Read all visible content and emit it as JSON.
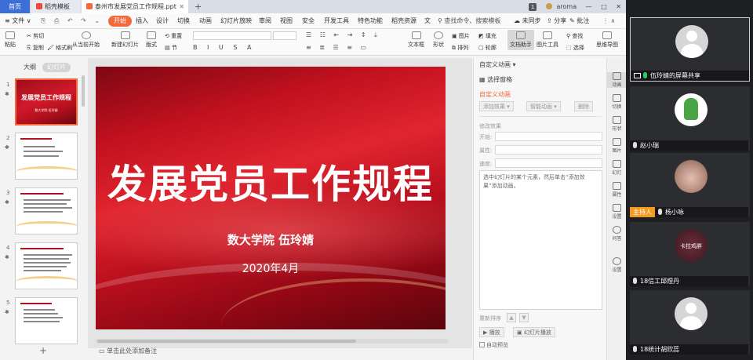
{
  "tabs": {
    "home": "首页",
    "t1": "稻壳模板",
    "t2": "泰州市发展党员工作规程.ppt",
    "plus": "+",
    "badge": "1",
    "user": "aroma",
    "min": "—",
    "max": "□",
    "close": "✕"
  },
  "menu": {
    "file": "≡ 文件 ∨",
    "items": [
      "开始",
      "插入",
      "设计",
      "切换",
      "动画",
      "幻灯片放映",
      "审阅",
      "视图",
      "安全",
      "开发工具",
      "特色功能",
      "稻壳资源",
      "文"
    ],
    "search": "查找命令、搜索模板",
    "unsync": "未同步",
    "share": "分享",
    "annotate": "批注"
  },
  "ribbon": {
    "paste": "粘贴",
    "cut": "剪切",
    "copy": "复制",
    "fmt": "格式刷",
    "fromcur": "从当前开始",
    "newslide": "新建幻灯片",
    "layout": "版式",
    "section": "节",
    "reset": "重置",
    "textbox": "文本框",
    "shape": "形状",
    "arrange": "排列",
    "pic": "图片",
    "fill": "填充",
    "outline": "轮廓",
    "textassist": "文档助手",
    "pictool": "图片工具",
    "find": "查找",
    "replace": "替换",
    "select": "选择",
    "mindmap": "思维导图"
  },
  "leftpane": {
    "outline_tab": "大纲",
    "slides_tab": "幻灯片",
    "add": "+",
    "thumb1_title": "发展党员工作规程",
    "thumb1_sub": "数大学院  伍玲婧",
    "numbers": [
      "1",
      "2",
      "3",
      "4",
      "5"
    ]
  },
  "slide": {
    "title": "发展党员工作规程",
    "author": "数大学院   伍玲婧",
    "date": "2020年4月"
  },
  "notes": {
    "placeholder": "单击此处添加备注"
  },
  "panel": {
    "title": "自定义动画 ▾",
    "select_pane": "选择窗格",
    "custom_head": "自定义动画",
    "add_effect": "添加效果 ▾",
    "smart_anim": "智能动画 ▾",
    "delete": "删除",
    "modify": "修改效果",
    "start": "开始:",
    "property": "属性:",
    "speed": "速度:",
    "hint": "选中幻灯片的某个元素，然后单击“添加效果”添加动画。",
    "reorder": "重新排序",
    "play": "播放",
    "slideshow": "幻灯片播放",
    "autopreview": "自动预览"
  },
  "rail": [
    "动画",
    "切换",
    "形状",
    "图片",
    "幻灯",
    "属性",
    "设置",
    "问答",
    "设置"
  ],
  "meeting": {
    "tiles": [
      {
        "name": "伍玲婧的屏幕共享",
        "kind": "share"
      },
      {
        "name": "赵小瑞",
        "kind": "dino"
      },
      {
        "name": "杨小咏",
        "kind": "girl",
        "host": "主持人"
      },
      {
        "name": "18信工邱煜丹",
        "kind": "dark",
        "caption": "卡拉鸡胖"
      },
      {
        "name": "18统计胡欣蕊",
        "kind": "plain"
      }
    ]
  },
  "colors": {
    "accent": "#f26a3a",
    "wps_blue": "#3b6fd6",
    "slide_red": "#c2111f",
    "meeting_bg": "#1e1f22",
    "host_orange": "#f29b1f",
    "mic_green": "#35c36b"
  }
}
